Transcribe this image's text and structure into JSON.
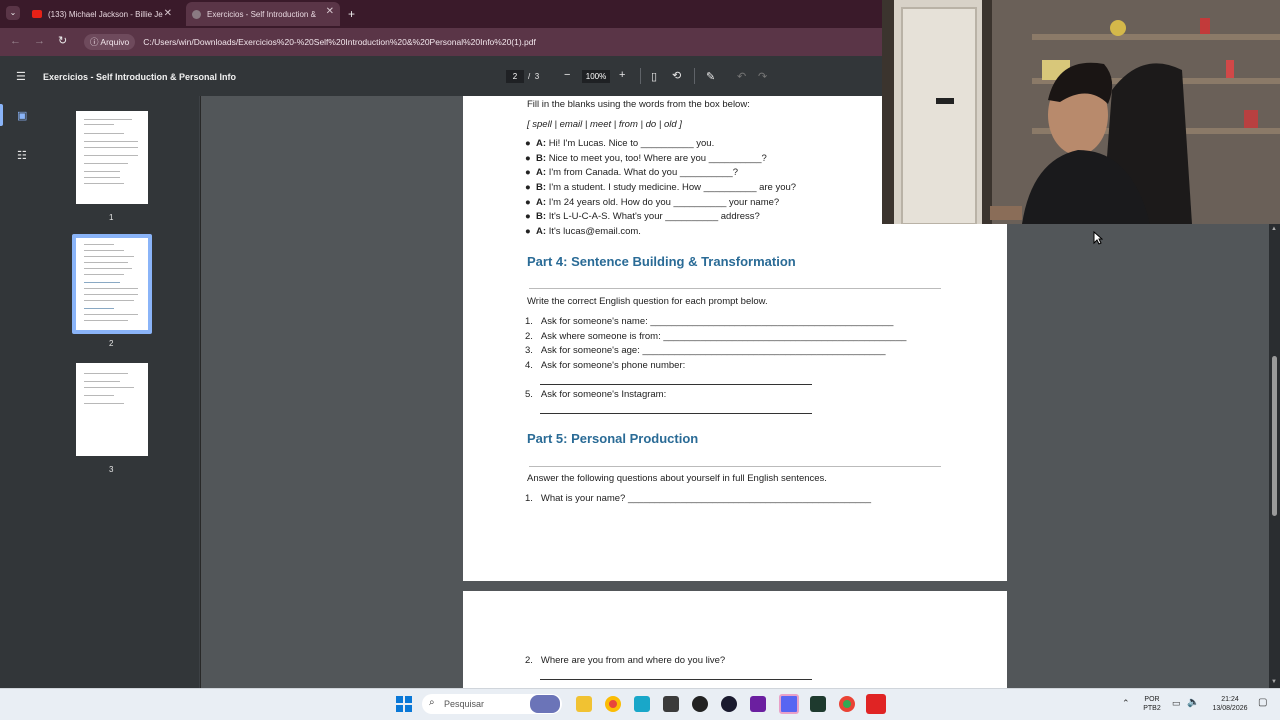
{
  "browser": {
    "tabs": [
      {
        "label": "(133) Michael Jackson - Billie Je",
        "active": false
      },
      {
        "label": "Exercicios - Self Introduction &",
        "active": true
      }
    ],
    "address_chip": "Arquivo",
    "url": "C:/Users/win/Downloads/Exercicios%20-%20Self%20Introduction%20&%20Personal%20Info%20(1).pdf"
  },
  "pdf_toolbar": {
    "title": "Exercicios - Self Introduction & Personal Info",
    "current_page": "2",
    "page_separator": "/",
    "total_pages": "3",
    "zoom": "100%"
  },
  "thumbnails": [
    {
      "label": "1",
      "selected": false
    },
    {
      "label": "2",
      "selected": true
    },
    {
      "label": "3",
      "selected": false
    }
  ],
  "page2": {
    "intro": "Fill in the blanks using the words from the box below:",
    "word_box": "[ spell | email | meet | from | do | old ]",
    "dialogue": [
      {
        "speaker": "A:",
        "text": " Hi! I'm Lucas. Nice to __________ you."
      },
      {
        "speaker": "B:",
        "text": " Nice to meet you, too! Where are you __________?"
      },
      {
        "speaker": "A:",
        "text": " I'm from Canada. What do you __________?"
      },
      {
        "speaker": "B:",
        "text": " I'm a student. I study medicine. How __________ are you?"
      },
      {
        "speaker": "A:",
        "text": " I'm 24 years old. How do you __________ your name?"
      },
      {
        "speaker": "B:",
        "text": " It's L-U-C-A-S. What's your __________ address?"
      },
      {
        "speaker": "A:",
        "text": " It's lucas@email.com."
      }
    ],
    "part4_heading": "Part 4: Sentence Building & Transformation",
    "part4_intro": "Write the correct English question for each prompt below.",
    "part4_items": [
      {
        "num": "1.",
        "text": "Ask for someone's name: ______________________________________________"
      },
      {
        "num": "2.",
        "text": "Ask where someone is from: ______________________________________________"
      },
      {
        "num": "3.",
        "text": "Ask for someone's age: ______________________________________________"
      },
      {
        "num": "4.",
        "text": "Ask for someone's phone number:"
      },
      {
        "num": "5.",
        "text": "Ask for someone's Instagram:"
      }
    ],
    "part5_heading": "Part 5: Personal Production",
    "part5_intro": "Answer the following questions about yourself in full English sentences.",
    "part5_items": [
      {
        "num": "1.",
        "text": "What is your name? ______________________________________________"
      }
    ]
  },
  "page3": {
    "items": [
      {
        "num": "2.",
        "text": "Where are you from and where do you live?"
      }
    ]
  },
  "taskbar": {
    "search_placeholder": "Pesquisar",
    "language": "POR",
    "keyboard": "PTB2",
    "time": "21:24",
    "date": "13/08/2026"
  },
  "colors": {
    "tab_bar": "#3a1a2a",
    "address_bar": "#5a3547",
    "pdf_toolbar": "#323639",
    "viewer_bg": "#525659",
    "heading_blue": "#2a6b96",
    "thumb_selected": "#8ab4f8"
  }
}
